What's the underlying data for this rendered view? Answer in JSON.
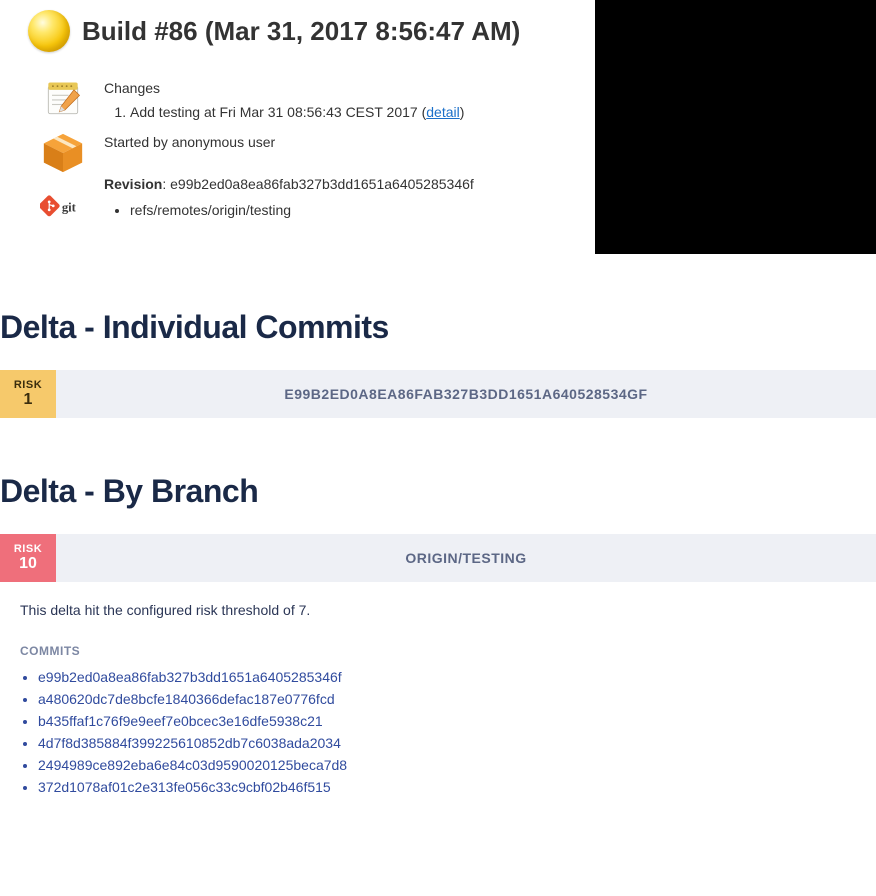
{
  "build": {
    "title": "Build #86 (Mar 31, 2017 8:56:47 AM)",
    "changes_label": "Changes",
    "change_item": "Add testing at Fri Mar 31 08:56:43 CEST 2017",
    "detail_link_text": "detail",
    "started_by": "Started by anonymous user",
    "revision_label": "Revision",
    "revision_hash": "e99b2ed0a8ea86fab327b3dd1651a6405285346f",
    "ref": "refs/remotes/origin/testing"
  },
  "delta_individual": {
    "heading": "Delta - Individual Commits",
    "risk_label": "RISK",
    "risk_value": "1",
    "commit_hash": "E99B2ED0A8EA86FAB327B3DD1651A640528534GF"
  },
  "delta_branch": {
    "heading": "Delta - By Branch",
    "risk_label": "RISK",
    "risk_value": "10",
    "branch_name": "ORIGIN/TESTING",
    "threshold_msg": "This delta hit the configured risk threshold of 7.",
    "commits_label": "COMMITS",
    "commits": [
      "e99b2ed0a8ea86fab327b3dd1651a6405285346f",
      "a480620dc7de8bcfe1840366defac187e0776fcd",
      "b435ffaf1c76f9e9eef7e0bcec3e16dfe5938c21",
      "4d7f8d385884f399225610852db7c6038ada2034",
      "2494989ce892eba6e84c03d9590020125beca7d8",
      "372d1078af01c2e313fe056c33c9cbf02b46f515"
    ]
  }
}
